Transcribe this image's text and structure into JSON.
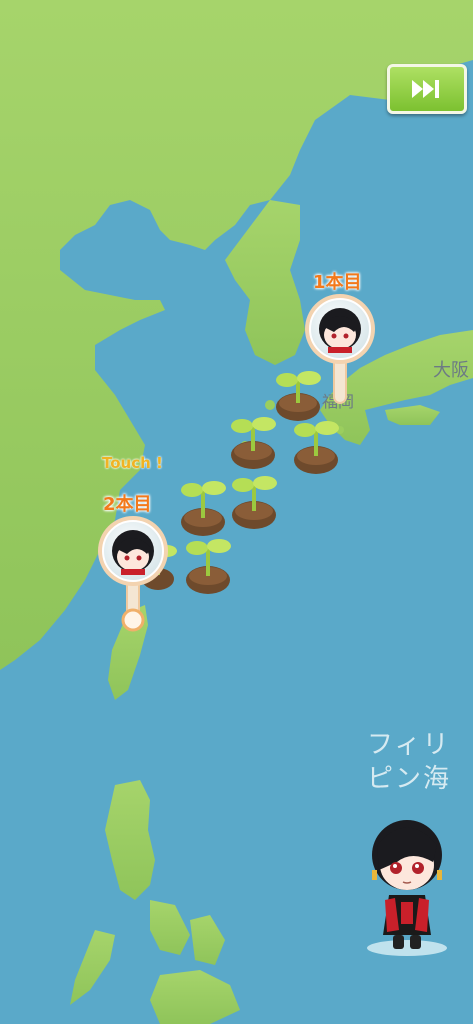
{
  "toolbar": {
    "skip_icon": "fast-forward-icon"
  },
  "map": {
    "places": {
      "osaka": "大阪",
      "fukuoka": "福岡"
    },
    "sea_label_line1": "フィリ",
    "sea_label_line2": "ピン海"
  },
  "pins": [
    {
      "label": "1本目"
    },
    {
      "label": "2本目",
      "hint": "Touch !"
    }
  ],
  "sprouts_count_visible": 7,
  "colors": {
    "ocean": "#5aa9c9",
    "land": "#9bce5e",
    "accent": "#f3791b",
    "button": "#8cc93e"
  }
}
